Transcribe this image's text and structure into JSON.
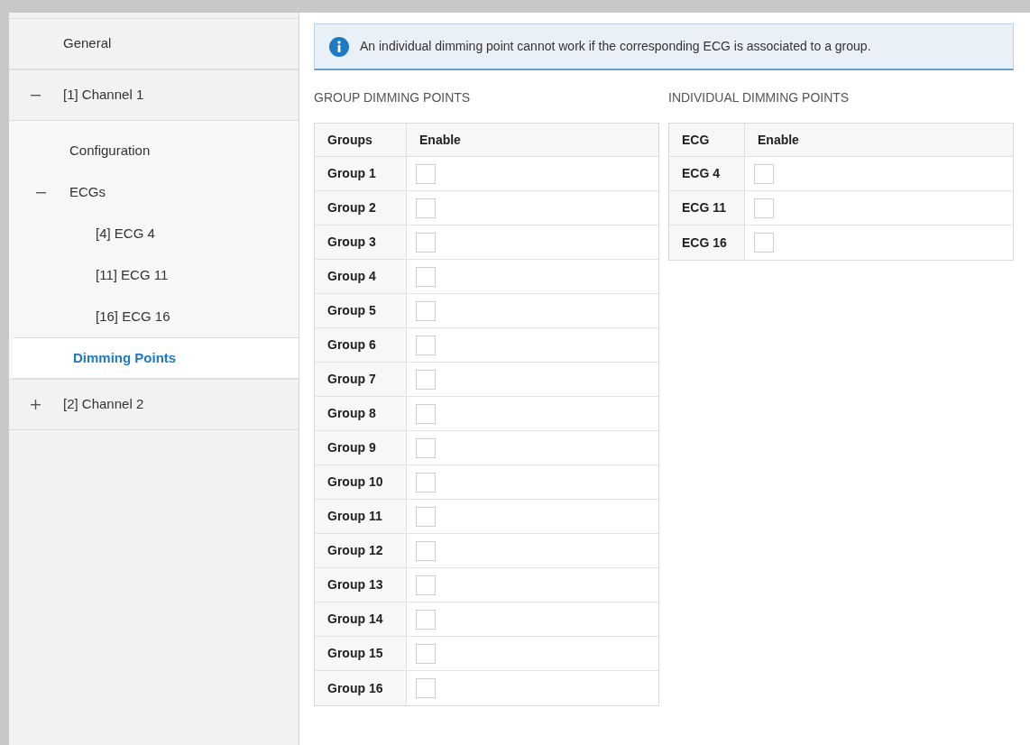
{
  "sidebar": {
    "items": [
      {
        "label": "General",
        "selected": false
      },
      {
        "label": "[1] Channel 1",
        "expanded": true,
        "selected": false,
        "children": [
          {
            "label": "Configuration",
            "selected": false
          },
          {
            "label": "ECGs",
            "expanded": true,
            "selected": false,
            "children": [
              {
                "label": "[4] ECG 4",
                "selected": false
              },
              {
                "label": "[11] ECG 11",
                "selected": false
              },
              {
                "label": "[16] ECG 16",
                "selected": false
              }
            ]
          },
          {
            "label": "Dimming Points",
            "selected": true
          }
        ]
      },
      {
        "label": "[2] Channel 2",
        "expanded": false,
        "selected": false
      }
    ]
  },
  "info": "An individual dimming point cannot work if the corresponding ECG is associated to a group.",
  "tables": [
    {
      "title": "GROUP DIMMING POINTS",
      "columns": [
        "Groups",
        "Enable"
      ],
      "rows": [
        {
          "label": "Group 1",
          "checked": false
        },
        {
          "label": "Group 2",
          "checked": false
        },
        {
          "label": "Group 3",
          "checked": false
        },
        {
          "label": "Group 4",
          "checked": false
        },
        {
          "label": "Group 5",
          "checked": false
        },
        {
          "label": "Group 6",
          "checked": false
        },
        {
          "label": "Group 7",
          "checked": false
        },
        {
          "label": "Group 8",
          "checked": false
        },
        {
          "label": "Group 9",
          "checked": false
        },
        {
          "label": "Group 10",
          "checked": false
        },
        {
          "label": "Group 11",
          "checked": false
        },
        {
          "label": "Group 12",
          "checked": false
        },
        {
          "label": "Group 13",
          "checked": false
        },
        {
          "label": "Group 14",
          "checked": false
        },
        {
          "label": "Group 15",
          "checked": false
        },
        {
          "label": "Group 16",
          "checked": false
        }
      ]
    },
    {
      "title": "INDIVIDUAL DIMMING POINTS",
      "columns": [
        "ECG",
        "Enable"
      ],
      "rows": [
        {
          "label": "ECG 4",
          "checked": false
        },
        {
          "label": "ECG 11",
          "checked": false
        },
        {
          "label": "ECG 16",
          "checked": false
        }
      ]
    }
  ]
}
